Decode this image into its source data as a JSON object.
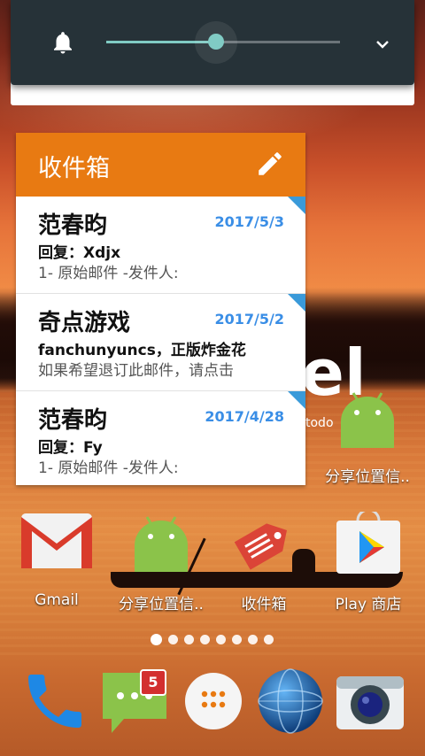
{
  "volume_panel": {
    "icon": "bell-icon",
    "level_fraction": 0.47,
    "expand_icon": "chevron-down-icon",
    "accent": "#80cbc4"
  },
  "inbox_widget": {
    "title": "收件箱",
    "edit_icon": "pencil-icon",
    "header_color": "#e87a12",
    "messages": [
      {
        "sender": "范春昀",
        "date": "2017/5/3",
        "subject": "回复：Xdjx",
        "snippet": "1- 原始邮件 -发件人:"
      },
      {
        "sender": "奇点游戏",
        "date": "2017/5/2",
        "subject": "fanchunyuncs，正版炸金花",
        "snippet": "如果希望退订此邮件，请点击"
      },
      {
        "sender": "范春昀",
        "date": "2017/4/28",
        "subject": "回复：Fy",
        "snippet": "1- 原始邮件 -发件人:"
      }
    ]
  },
  "background_fragment": {
    "big": "el",
    "small": "todo"
  },
  "apps_row_top": [
    {
      "label": "分享位置信..",
      "icon": "android-icon"
    }
  ],
  "apps_row": [
    {
      "label": "Gmail",
      "icon": "gmail-icon"
    },
    {
      "label": "分享位置信..",
      "icon": "android-icon"
    },
    {
      "label": "收件箱",
      "icon": "inbox-icon"
    },
    {
      "label": "Play 商店",
      "icon": "play-store-icon"
    }
  ],
  "page_indicator": {
    "pages": 8,
    "current": 1
  },
  "dock": {
    "items": [
      {
        "icon": "phone-icon"
      },
      {
        "icon": "messaging-icon",
        "badge": "5"
      },
      {
        "icon": "app-drawer-icon"
      },
      {
        "icon": "browser-icon"
      },
      {
        "icon": "camera-icon"
      }
    ]
  }
}
